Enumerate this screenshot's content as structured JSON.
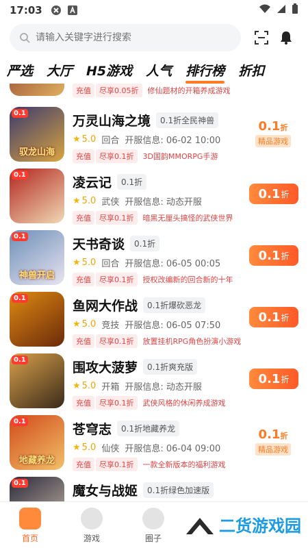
{
  "status_bar": {
    "time": "17:03",
    "icons": [
      "close-icon",
      "app-a-icon",
      "wifi-icon",
      "signal-icon",
      "battery-icon"
    ]
  },
  "search": {
    "placeholder": "请输入关键字进行搜索"
  },
  "tabs": [
    {
      "label": "严选"
    },
    {
      "label": "大厅"
    },
    {
      "label": "H5游戏"
    },
    {
      "label": "人气"
    },
    {
      "label": "排行榜",
      "active": true
    },
    {
      "label": "折扣"
    }
  ],
  "partial_top": {
    "promo_a": "充值",
    "promo_b": "尽享0.05折",
    "desc": "修仙题材的开箱养成游戏"
  },
  "games": [
    {
      "title": "万灵山海之境",
      "tag": "0.1折全民神兽",
      "rating": "5.0",
      "genre": "回合",
      "server": "开服信息: 06-02 10:00",
      "promo_a": "充值",
      "promo_b": "尽享0.1折",
      "desc": "3D国韵MMORPG手游",
      "discount": "0.1",
      "unit": "折",
      "badge_label": "精品游戏",
      "style": "badge",
      "art_text": "驭龙山海",
      "colors": [
        "#3b3a6e",
        "#d9a441"
      ]
    },
    {
      "title": "凌云记",
      "tag": "0.1折",
      "rating": "5.0",
      "genre": "武侠",
      "server": "开服信息: 动态开服",
      "promo_a": "充值",
      "promo_b": "尽享0.1折",
      "desc": "暗黑无厘头搞怪的武侠世界",
      "discount": "0.1",
      "unit": "折",
      "style": "button",
      "art_text": "",
      "colors": [
        "#b3261e",
        "#f0d9b5"
      ]
    },
    {
      "title": "天书奇谈",
      "tag": "0.1折",
      "rating": "5.0",
      "genre": "回合",
      "server": "开服信息: 06-05 00:05",
      "promo_a": "充值",
      "promo_b": "尽享0.1折",
      "desc": "授权改编新的回合新的十年",
      "discount": "0.1",
      "unit": "折",
      "style": "button",
      "art_text": "神兽开启",
      "colors": [
        "#6c8fb8",
        "#e9e4f0"
      ]
    },
    {
      "title": "鱼网大作战",
      "tag": "0.1折爆砍恶龙",
      "rating": "5.0",
      "genre": "竞技",
      "server": "开服信息: 06-05 07:50",
      "promo_a": "充值",
      "promo_b": "尽享0.1折",
      "desc": "放置挂机RPG角色扮演小游戏",
      "discount": "0.1",
      "unit": "折",
      "style": "button",
      "art_text": "",
      "colors": [
        "#e08a12",
        "#6a2a0a"
      ]
    },
    {
      "title": "围攻大菠萝",
      "tag": "0.1折爽充版",
      "rating": "5.0",
      "genre": "开箱",
      "server": "开服信息: 动态开服",
      "promo_a": "充值",
      "promo_b": "尽享0.1折",
      "desc": "武侠风格的休闲养成游戏",
      "discount": "0.1",
      "unit": "折",
      "style": "button",
      "art_text": "",
      "colors": [
        "#d8a04a",
        "#3a2a1a"
      ]
    },
    {
      "title": "苍穹志",
      "tag": "0.1折地藏养龙",
      "rating": "5.0",
      "genre": "仙侠",
      "server": "开服信息: 06-04 09:00",
      "promo_a": "充值",
      "promo_b": "尽享0.1折",
      "desc": "一款全新版本的福利游戏",
      "discount": "0.1",
      "unit": "折",
      "badge_label": "精品游戏",
      "style": "badge",
      "art_text": "地藏养龙",
      "colors": [
        "#d14a1a",
        "#f2c06a"
      ]
    },
    {
      "title": "魔女与战姬",
      "tag": "0.1折绿色加速版",
      "rating": "",
      "genre": "",
      "server": "",
      "promo_a": "",
      "promo_b": "",
      "desc": "",
      "discount": "",
      "unit": "",
      "style": "none",
      "art_text": "",
      "colors": [
        "#2a2a3a",
        "#c8b8a8"
      ]
    }
  ],
  "bottom_nav": [
    {
      "label": "首页",
      "active": true
    },
    {
      "label": "游戏"
    },
    {
      "label": "圈子"
    }
  ],
  "watermark": {
    "text": "二货游戏园"
  }
}
